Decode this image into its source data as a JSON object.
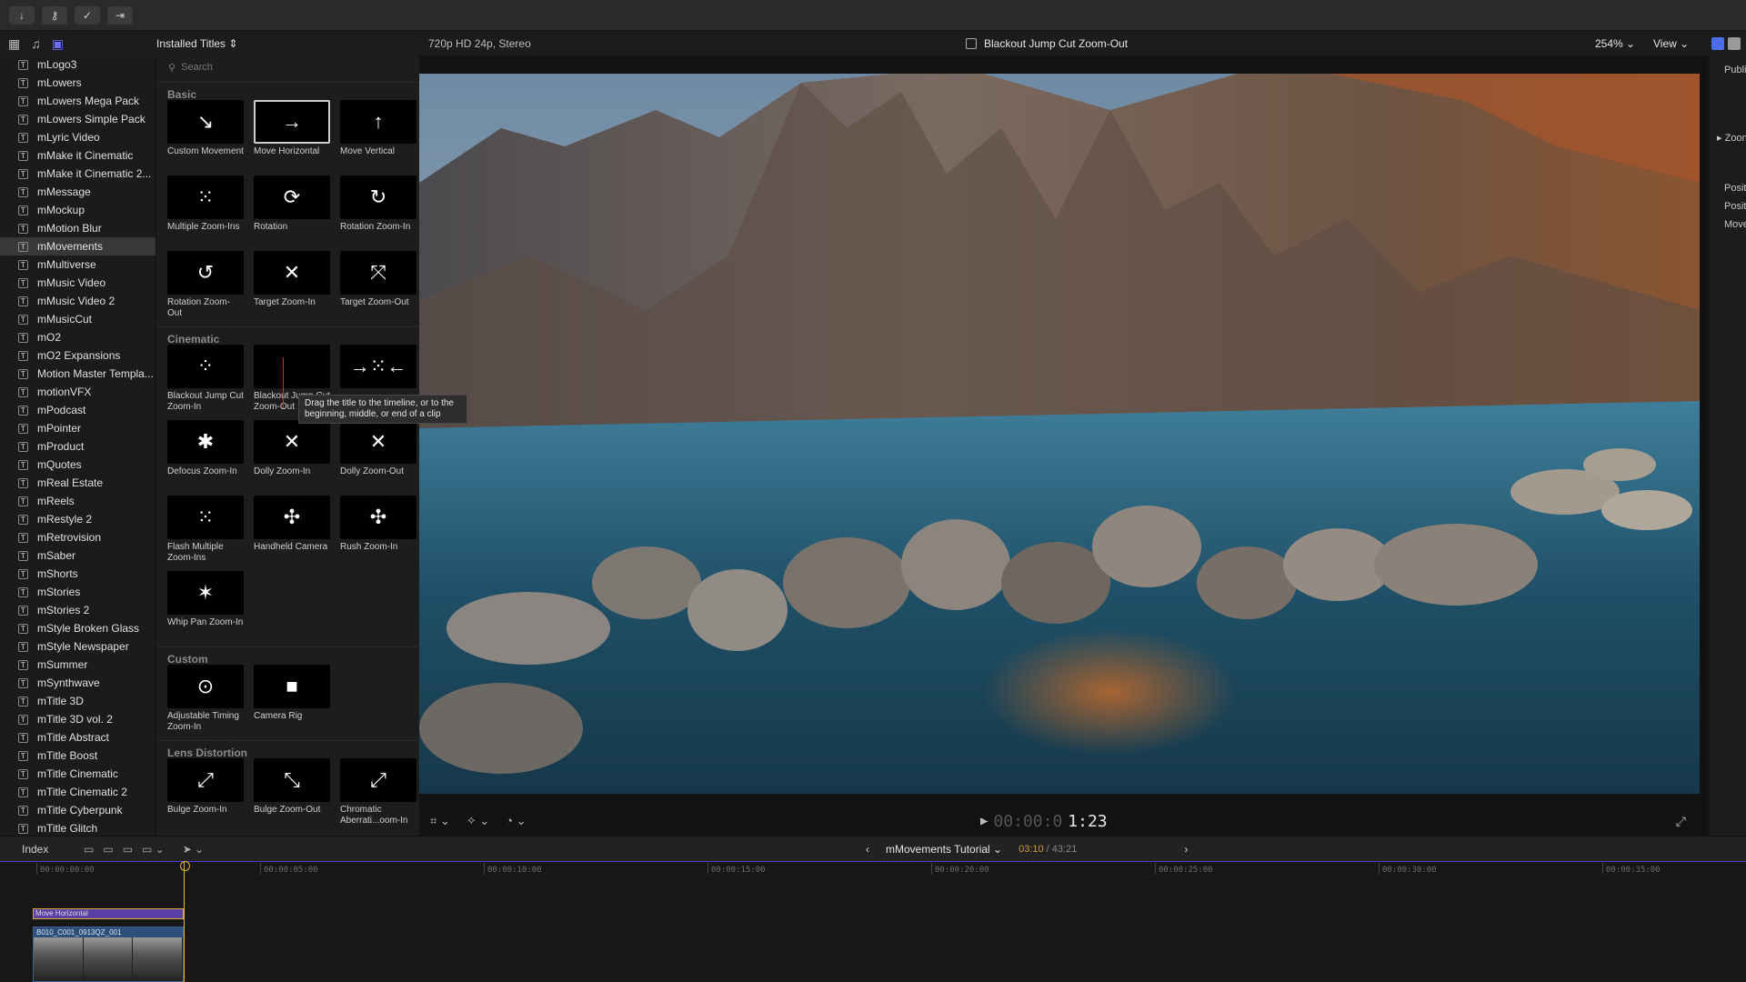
{
  "sidebar": {
    "items": [
      "mLogo3",
      "mLowers",
      "mLowers Mega Pack",
      "mLowers Simple Pack",
      "mLyric Video",
      "mMake it Cinematic",
      "mMake it Cinematic 2...",
      "mMessage",
      "mMockup",
      "mMotion Blur",
      "mMovements",
      "mMultiverse",
      "mMusic Video",
      "mMusic Video 2",
      "mMusicCut",
      "mO2",
      "mO2 Expansions",
      "Motion Master Templa...",
      "motionVFX",
      "mPodcast",
      "mPointer",
      "mProduct",
      "mQuotes",
      "mReal Estate",
      "mReels",
      "mRestyle 2",
      "mRetrovision",
      "mSaber",
      "mShorts",
      "mStories",
      "mStories 2",
      "mStyle Broken Glass",
      "mStyle Newspaper",
      "mSummer",
      "mSynthwave",
      "mTitle 3D",
      "mTitle 3D vol. 2",
      "mTitle Abstract",
      "mTitle Boost",
      "mTitle Cinematic",
      "mTitle Cinematic 2",
      "mTitle Cyberpunk",
      "mTitle Glitch"
    ],
    "selected": "mMovements"
  },
  "browser": {
    "title": "Installed Titles",
    "search_placeholder": "Search",
    "categories": [
      {
        "name": "Basic",
        "tiles": [
          {
            "label": "Custom Movement",
            "glyph": "↘",
            "selected": false
          },
          {
            "label": "Move Horizontal",
            "glyph": "→",
            "selected": true
          },
          {
            "label": "Move Vertical",
            "glyph": "↑",
            "selected": false
          },
          {
            "label": "Multiple Zoom-Ins",
            "glyph": "⁙",
            "selected": false
          },
          {
            "label": "Rotation",
            "glyph": "⟳",
            "selected": false
          },
          {
            "label": "Rotation Zoom-In",
            "glyph": "↻",
            "selected": false
          },
          {
            "label": "Rotation Zoom-Out",
            "glyph": "↺",
            "selected": false
          },
          {
            "label": "Target Zoom-In",
            "glyph": "✕",
            "selected": false
          },
          {
            "label": "Target Zoom-Out",
            "glyph": "⤧",
            "selected": false
          }
        ]
      },
      {
        "name": "Cinematic",
        "tiles": [
          {
            "label": "Blackout Jump Cut Zoom-In",
            "glyph": "⁘",
            "selected": false
          },
          {
            "label": "Blackout Jump Cut Zoom-Out",
            "glyph": "",
            "selected": false
          },
          {
            "label": "",
            "glyph": "→⁙←",
            "selected": false
          },
          {
            "label": "Defocus Zoom-In",
            "glyph": "✱",
            "selected": false
          },
          {
            "label": "Dolly Zoom-In",
            "glyph": "✕",
            "selected": false
          },
          {
            "label": "Dolly Zoom-Out",
            "glyph": "✕",
            "selected": false
          },
          {
            "label": "Flash Multiple Zoom-Ins",
            "glyph": "⁙",
            "selected": false
          },
          {
            "label": "Handheld Camera",
            "glyph": "✣",
            "selected": false
          },
          {
            "label": "Rush Zoom-In",
            "glyph": "✣",
            "selected": false
          },
          {
            "label": "Whip Pan Zoom-In",
            "glyph": "✶",
            "selected": false
          }
        ]
      },
      {
        "name": "Custom",
        "tiles": [
          {
            "label": "Adjustable Timing Zoom-In",
            "glyph": "⊙",
            "selected": false
          },
          {
            "label": "Camera Rig",
            "glyph": "■",
            "selected": false
          }
        ]
      },
      {
        "name": "Lens Distortion",
        "tiles": [
          {
            "label": "Bulge Zoom-In",
            "glyph": "⤢",
            "selected": false
          },
          {
            "label": "Bulge Zoom-Out",
            "glyph": "⤡",
            "selected": false
          },
          {
            "label": "Chromatic Aberrati...oom-In",
            "glyph": "⤢",
            "selected": false
          }
        ]
      }
    ],
    "tooltip": "Drag the title to the timeline, or to the beginning, middle, or end of a clip"
  },
  "viewer": {
    "format": "720p HD 24p, Stereo",
    "clip_name": "Blackout Jump Cut Zoom-Out",
    "zoom": "254%",
    "view_label": "View",
    "timecode_dim": "00:00:0",
    "timecode_bright": "1:23"
  },
  "inspector": {
    "heading": "Publi",
    "zoom_label": "Zoon",
    "rows": [
      "Posit",
      "Posit",
      "Move"
    ]
  },
  "timeline": {
    "index_label": "Index",
    "project_name": "mMovements Tutorial",
    "position": "03:10",
    "duration": "43:21",
    "ruler": [
      "00:00:00:00",
      "00:00:05:00",
      "00:00:10:00",
      "00:00:15:00",
      "00:00:20:00",
      "00:00:25:00",
      "00:00:30:00",
      "00:00:35:00"
    ],
    "title_clip": "Move Horizontal",
    "video_clip": "B010_C001_0913QZ_001"
  },
  "colors": {
    "accent": "#6b6bff",
    "title_clip": "#5a3fa6",
    "video_clip": "#2e4f7a",
    "playhead": "#e2b53d"
  }
}
